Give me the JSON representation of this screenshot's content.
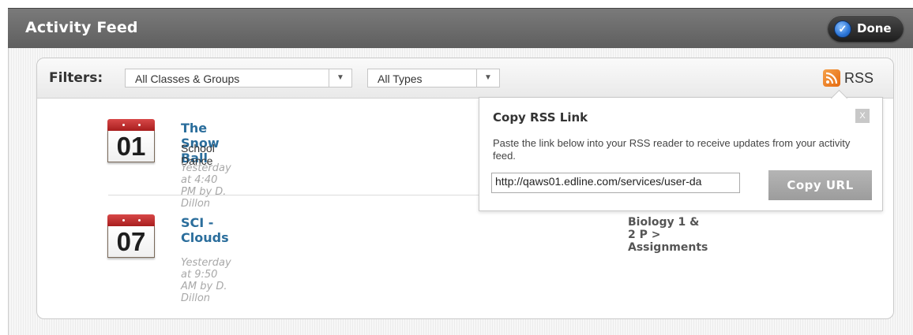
{
  "header": {
    "title": "Activity Feed",
    "done_label": "Done",
    "done_icon": "checkmark-icon"
  },
  "filters": {
    "label": "Filters:",
    "class_select": "All Classes & Groups",
    "type_select": "All Types",
    "rss_label": "RSS",
    "rss_icon": "rss-icon"
  },
  "feed": [
    {
      "day": "01",
      "title": "The Snow Ball",
      "subtitle": "School Dance",
      "meta": "Yesterday at 4:40 PM by D. Dillon"
    },
    {
      "day": "07",
      "title": "SCI - Clouds",
      "subtitle": "",
      "meta": "Yesterday at 9:50 AM by D. Dillon",
      "breadcrumb": "Biology 1 & 2 P > Assignments"
    }
  ],
  "rss_popup": {
    "title": "Copy RSS Link",
    "close_label": "X",
    "description": "Paste the link below into your RSS reader to receive updates from your activity feed.",
    "url": "http://qaws01.edline.com/services/user-da",
    "copy_label": "Copy URL"
  },
  "colors": {
    "header_bg": "#6b6b6b",
    "link": "#2b6e9c",
    "calendar_red": "#c02a2a",
    "rss_orange": "#ee8322"
  }
}
